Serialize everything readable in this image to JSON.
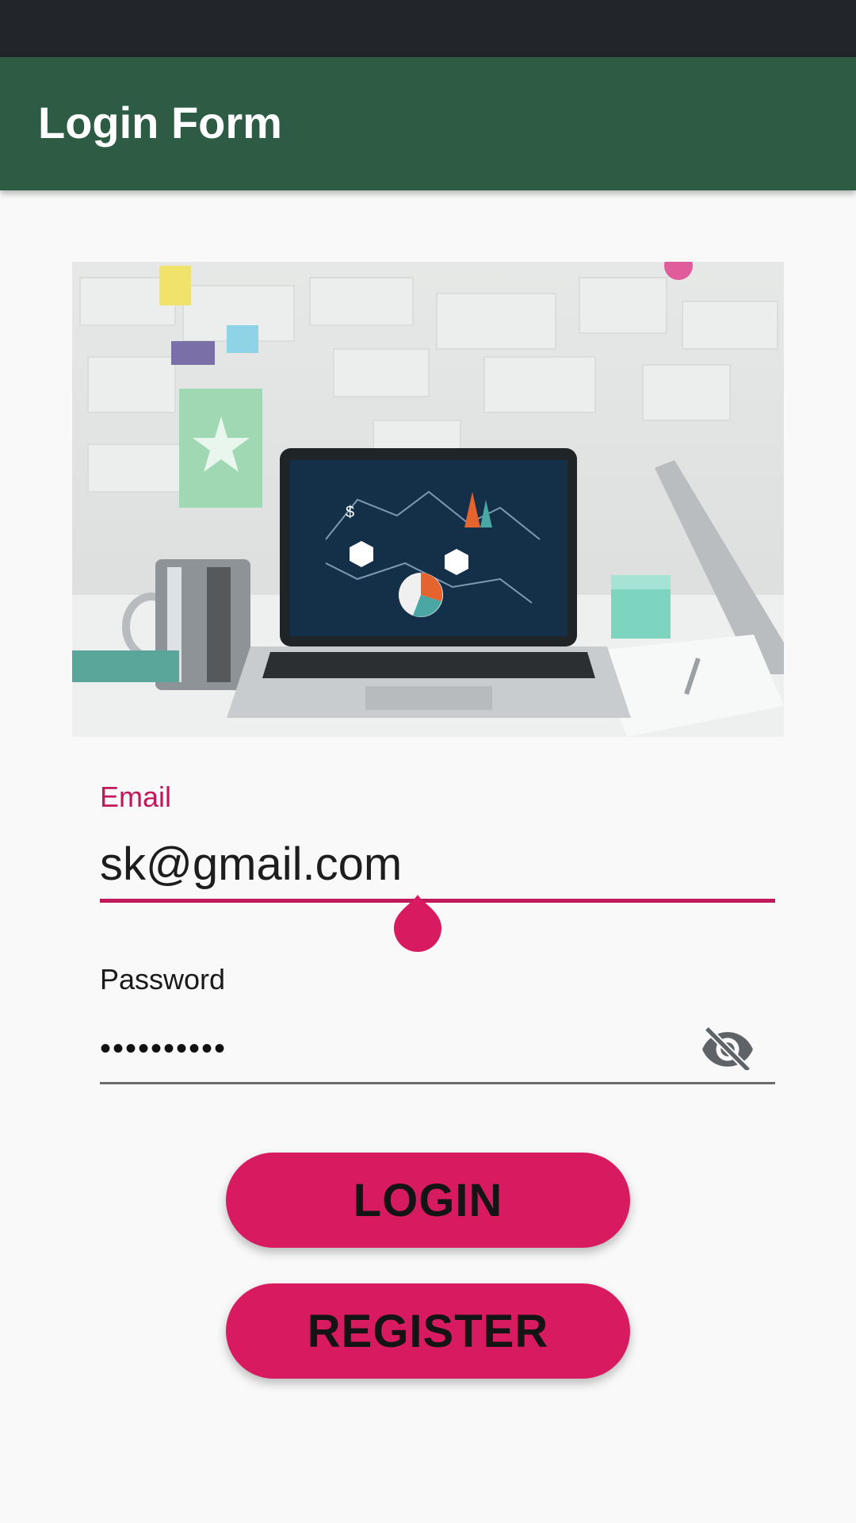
{
  "app": {
    "title": "Login Form"
  },
  "hero": {
    "image": "laptop-on-desk-photo"
  },
  "email": {
    "label": "Email",
    "value": "sk@gmail.com",
    "accent": "#c2185b"
  },
  "password": {
    "label": "Password",
    "value": "••••••••••",
    "toggle_icon": "visibility-off-icon"
  },
  "buttons": {
    "login": "LOGIN",
    "register": "REGISTER",
    "color": "#d81b60"
  },
  "colors": {
    "appbar": "#2e5b44",
    "statusbar": "#22262b",
    "background": "#f8f9f8"
  }
}
